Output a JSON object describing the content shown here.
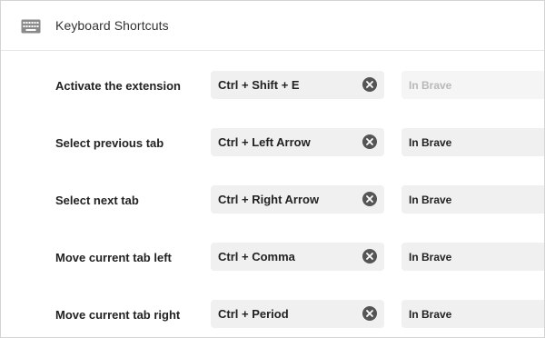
{
  "header": {
    "icon": "keyboard-icon",
    "title": "Keyboard Shortcuts"
  },
  "shortcuts": [
    {
      "label": "Activate the extension",
      "keys": "Ctrl + Shift + E",
      "scope": "In Brave",
      "scope_enabled": false
    },
    {
      "label": "Select previous tab",
      "keys": "Ctrl + Left Arrow",
      "scope": "In Brave",
      "scope_enabled": true
    },
    {
      "label": "Select next tab",
      "keys": "Ctrl + Right Arrow",
      "scope": "In Brave",
      "scope_enabled": true
    },
    {
      "label": "Move current tab left",
      "keys": "Ctrl + Comma",
      "scope": "In Brave",
      "scope_enabled": true
    },
    {
      "label": "Move current tab right",
      "keys": "Ctrl + Period",
      "scope": "In Brave",
      "scope_enabled": true
    }
  ],
  "colors": {
    "field_bg": "#f0f0f0",
    "clear_button": "#555555",
    "disabled_text": "#b8b8b8"
  }
}
